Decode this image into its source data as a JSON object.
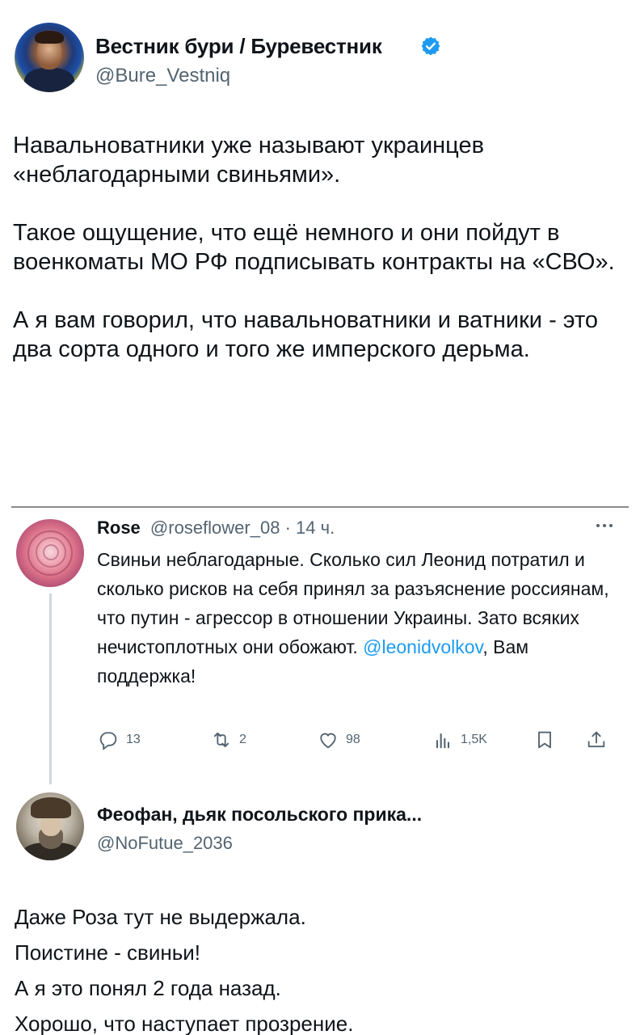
{
  "author": {
    "display_name": "Вестник бури / Буревестник",
    "handle": "@Bure_Vestniq",
    "verified_color": "#1d9bf0"
  },
  "tweet": {
    "paragraphs": [
      "Навальноватники уже называют украинцев «неблагодарными свиньями».",
      "Такое ощущение, что ещё немного и они пойдут в военкоматы МО РФ подписывать контракты на «СВО».",
      "А я вам говорил, что навальноватники и ватники - это два сорта одного и того же имперского дерьма."
    ]
  },
  "quoted_reply": {
    "name": "Rose",
    "handle": "@roseflower_08",
    "separator": "·",
    "time": "14 ч.",
    "text_before_mention": "Свиньи неблагодарные. Сколько сил Леонид потратил и сколько рисков на себя принял за разъяснение россиянам, что путин - агрессор в отношении Украины. Зато всяких нечистоплотных они обожают. ",
    "mention": "@leonidvolkov",
    "text_after_mention": ", Вам поддержка!",
    "stats": {
      "replies": "13",
      "retweets": "2",
      "likes": "98",
      "views": "1,5K"
    },
    "icons": [
      "reply-icon",
      "retweet-icon",
      "like-icon",
      "views-icon",
      "bookmark-icon",
      "share-icon",
      "more-icon"
    ]
  },
  "second_reply": {
    "name": "Феофан, дьяк посольского прика...",
    "handle": "@NoFutue_2036",
    "lines": [
      "Даже Роза тут не выдержала.",
      "Поистине - свиньи!",
      "А я это понял 2 года назад.",
      "Хорошо, что наступает прозрение."
    ]
  },
  "colors": {
    "text": "#0f1419",
    "secondary": "#536471",
    "link": "#1d9bf0",
    "divider": "#8a8a8a"
  }
}
